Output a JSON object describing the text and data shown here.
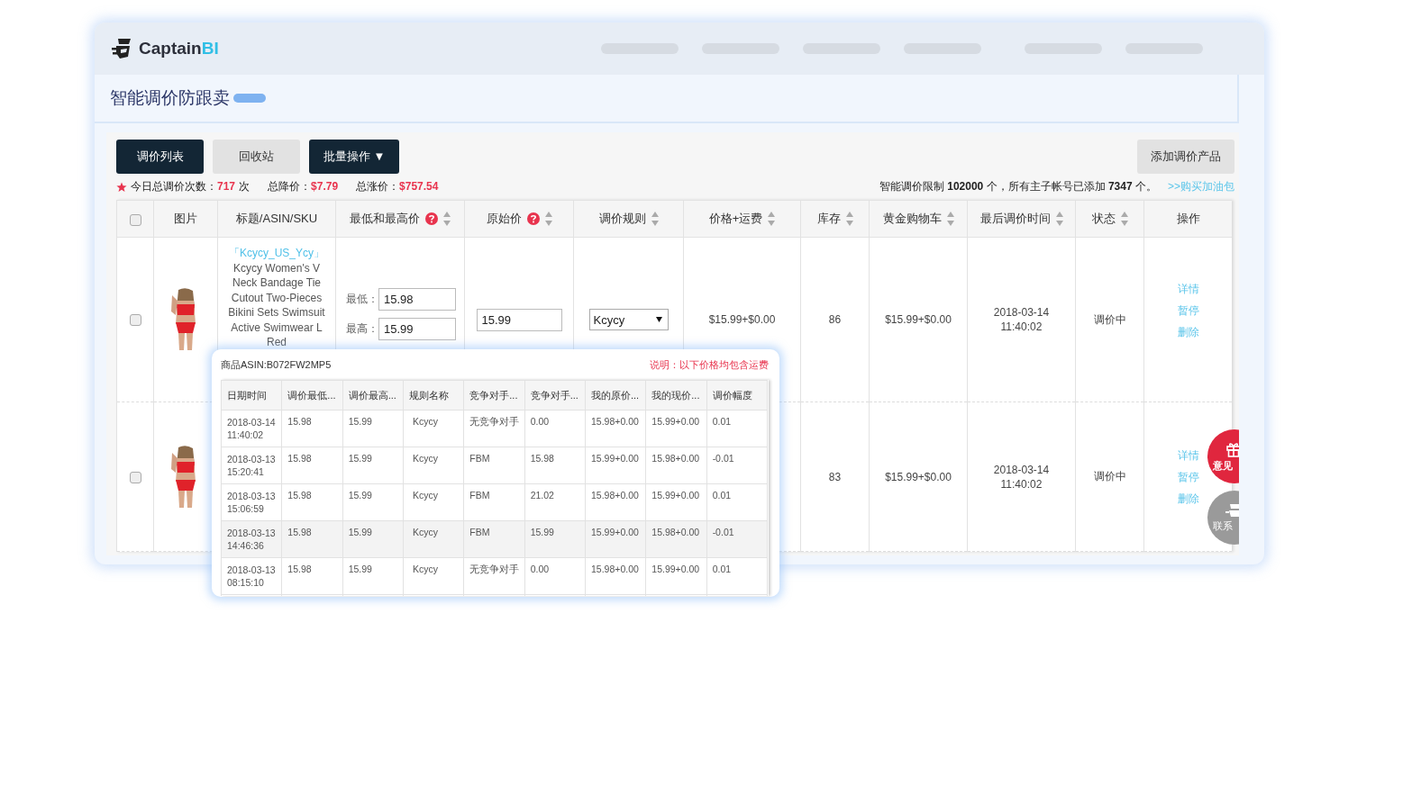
{
  "header": {
    "logo": {
      "name": "Captain",
      "accent": "BI"
    }
  },
  "page_title": "智能调价防跟卖",
  "tabs": [
    {
      "label": "调价列表",
      "selected": true
    },
    {
      "label": "回收站",
      "selected": false
    }
  ],
  "batch_button": {
    "label": "批量操作",
    "caret": "▼"
  },
  "add_button": "添加调价产品",
  "stats": [
    {
      "label": "今日总调价次数：",
      "value": "717",
      "unit": "次"
    },
    {
      "label": "总降价：",
      "value": "$7.79"
    },
    {
      "label": "总涨价：",
      "value": "$757.54"
    }
  ],
  "quota_note": "智能调价限制 **102000** 个，所有主子帐号已添加 **7347** 个。",
  "buy_link": ">>购买加油包",
  "table": {
    "columns": [
      {
        "kind": "checkbox",
        "checked": false
      },
      {
        "kind": "text",
        "label": "图片",
        "sortable": false,
        "help": false
      },
      {
        "kind": "text",
        "label": "标题/ASIN/SKU",
        "sortable": false,
        "help": false
      },
      {
        "kind": "text",
        "label": "最低和最高价",
        "sortable": true,
        "help": true
      },
      {
        "kind": "text",
        "label": "原始价",
        "sortable": true,
        "help": true
      },
      {
        "kind": "text",
        "label": "调价规则",
        "sortable": true,
        "help": false
      },
      {
        "kind": "text",
        "label": "价格+运费",
        "sortable": true,
        "help": false
      },
      {
        "kind": "text",
        "label": "库存",
        "sortable": true,
        "help": false
      },
      {
        "kind": "text",
        "label": "黄金购物车",
        "sortable": true,
        "help": false
      },
      {
        "kind": "text",
        "label": "最后调价时间",
        "sortable": true,
        "help": false
      },
      {
        "kind": "text",
        "label": "状态",
        "sortable": true,
        "help": false
      },
      {
        "kind": "text",
        "label": "操作",
        "sortable": false,
        "help": false
      }
    ],
    "rows": [
      {
        "checked": false,
        "title": {
          "store": "「Kcycy_US_Ycy」",
          "text": "Kcycy Women's V Neck Bandage Tie Cutout Two-Pieces Bikini Sets Swimsuit Active Swimwear L Red"
        },
        "min_label": "最低：",
        "min": "15.98",
        "max_label": "最高：",
        "max": "15.99",
        "original": "15.99",
        "rule": "Kcycy",
        "price_shipping": "$15.99+$0.00",
        "stock": "86",
        "buybox": "$15.99+$0.00",
        "last_adjusted": "2018-03-14 11:40:02",
        "status": "调价中",
        "actions": [
          "详情",
          "暂停",
          "删除"
        ]
      },
      {
        "checked": false,
        "stock": "83",
        "buybox": "$15.99+$0.00",
        "last_adjusted": "2018-03-14 11:40:02",
        "status": "调价中",
        "actions": [
          "详情",
          "暂停",
          "删除"
        ]
      }
    ]
  },
  "history_popup": {
    "asin": "商品ASIN:B072FW2MP5",
    "note": "说明：以下价格均包含运费",
    "columns": [
      "日期时间",
      "调价最低...",
      "调价最高...",
      "规则名称",
      "竞争对手...",
      "竞争对手...",
      "我的原价...",
      "我的现价...",
      "调价幅度"
    ],
    "rows": [
      {
        "highlighted": false,
        "cells": [
          "2018-03-14 11:40:02",
          "15.98",
          "15.99",
          "Kcycy",
          "无竞争对手",
          "0.00",
          "15.98+0.00",
          "15.99+0.00",
          "0.01"
        ]
      },
      {
        "highlighted": false,
        "cells": [
          "2018-03-13 15:20:41",
          "15.98",
          "15.99",
          "Kcycy",
          "FBM",
          "15.98",
          "15.99+0.00",
          "15.98+0.00",
          "-0.01"
        ]
      },
      {
        "highlighted": false,
        "cells": [
          "2018-03-13 15:06:59",
          "15.98",
          "15.99",
          "Kcycy",
          "FBM",
          "21.02",
          "15.98+0.00",
          "15.99+0.00",
          "0.01"
        ]
      },
      {
        "highlighted": true,
        "cells": [
          "2018-03-13 14:46:36",
          "15.98",
          "15.99",
          "Kcycy",
          "FBM",
          "15.99",
          "15.99+0.00",
          "15.98+0.00",
          "-0.01"
        ]
      },
      {
        "highlighted": false,
        "cells": [
          "2018-03-13 08:15:10",
          "15.98",
          "15.99",
          "Kcycy",
          "无竞争对手",
          "0.00",
          "15.98+0.00",
          "15.99+0.00",
          "0.01"
        ]
      }
    ]
  },
  "side_buttons": [
    {
      "kind": "feedback",
      "label": "意见"
    },
    {
      "kind": "contact",
      "label": "联系"
    }
  ]
}
